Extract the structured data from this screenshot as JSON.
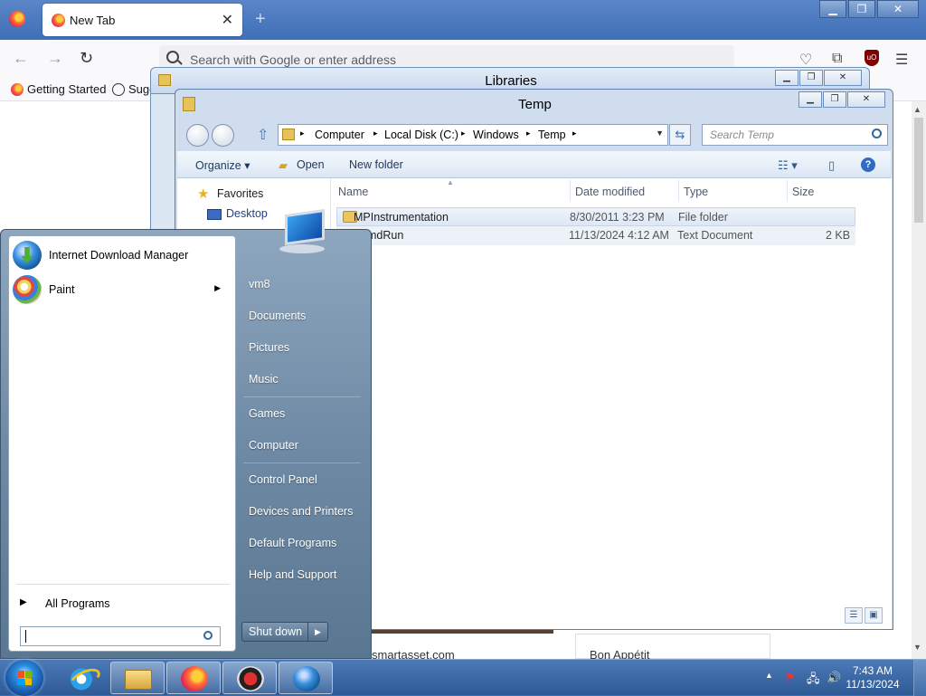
{
  "firefox": {
    "tab_title": "New Tab",
    "url_placeholder": "Search with Google or enter address",
    "bookmarks": [
      "Getting Started",
      "Sugg"
    ],
    "ublock_label": "uO"
  },
  "libraries_window": {
    "title": "Libraries"
  },
  "temp_window": {
    "title": "Temp",
    "breadcrumb": [
      "Computer",
      "Local Disk (C:)",
      "Windows",
      "Temp"
    ],
    "search_placeholder": "Search Temp",
    "toolbar": {
      "organize": "Organize",
      "open": "Open",
      "new_folder": "New folder"
    },
    "nav": {
      "favorites": "Favorites",
      "desktop": "Desktop"
    },
    "columns": [
      "Name",
      "Date modified",
      "Type",
      "Size"
    ],
    "files": [
      {
        "name": "MPInstrumentation",
        "date": "8/30/2011 3:23 PM",
        "type": "File folder",
        "size": ""
      },
      {
        "name": "eCmdRun",
        "date": "11/13/2024 4:12 AM",
        "type": "Text Document",
        "size": "2 KB"
      }
    ]
  },
  "start_menu": {
    "pinned": [
      {
        "label": "Internet Download Manager",
        "icon": "idm-icon"
      },
      {
        "label": "Paint",
        "icon": "paint-icon"
      }
    ],
    "all_programs": "All Programs",
    "right": [
      "vm8",
      "Documents",
      "Pictures",
      "Music",
      "Games",
      "Computer",
      "Control Panel",
      "Devices and Printers",
      "Default Programs",
      "Help and Support"
    ],
    "shutdown": "Shut down"
  },
  "background_page": {
    "left_text": "smartasset.com",
    "right_text": "Bon Appétit"
  },
  "taskbar": {
    "time": "7:43 AM",
    "date": "11/13/2024"
  }
}
